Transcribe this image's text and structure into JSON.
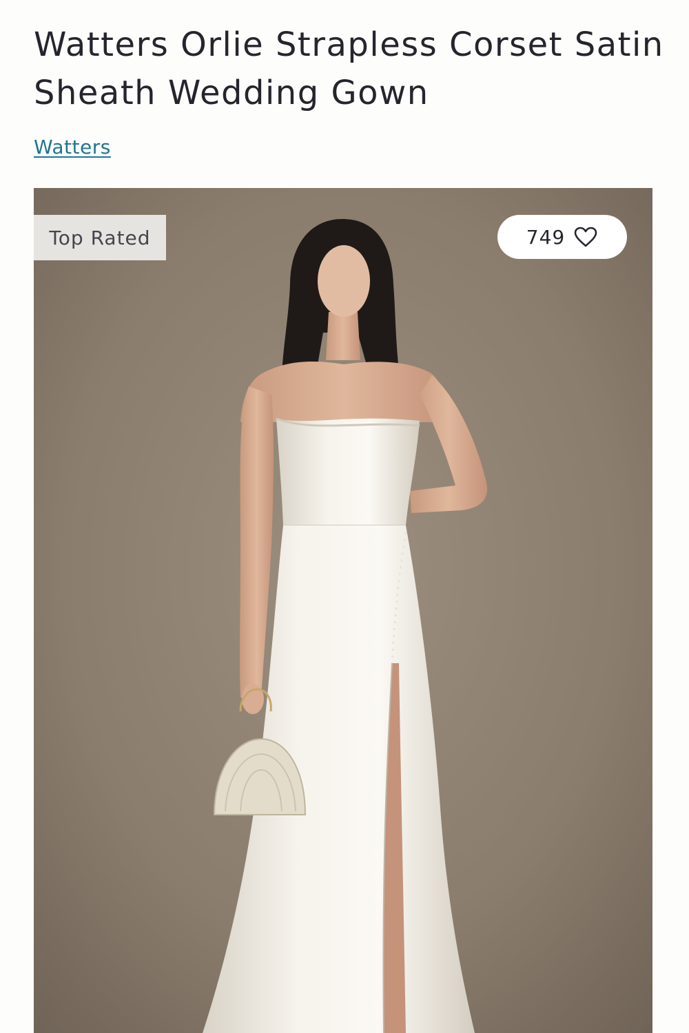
{
  "product": {
    "title": "Watters Orlie Strapless Corset Satin Sheath Wedding Gown",
    "brand": "Watters"
  },
  "image": {
    "badge": "Top Rated",
    "wishlist_count": "749",
    "icons": {
      "wishlist": "heart-outline-icon"
    }
  },
  "colors": {
    "title": "#25252d",
    "brand_link": "#1f7591",
    "badge_background": "#e6e4e1",
    "photo_background": "#8f8171"
  }
}
